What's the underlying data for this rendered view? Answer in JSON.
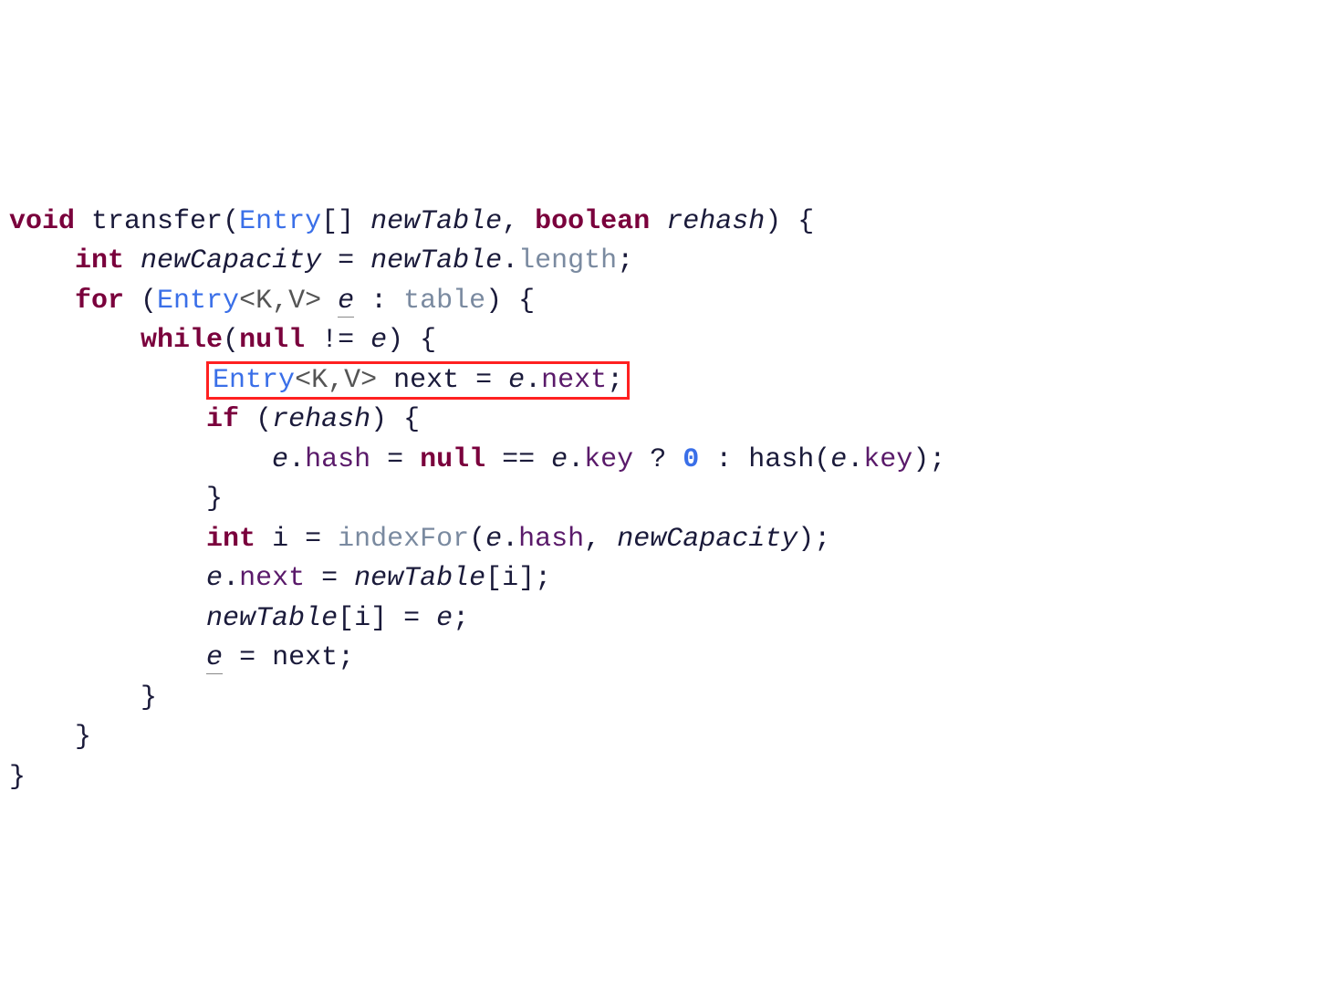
{
  "line1": {
    "void": "void",
    "fn": "transfer",
    "entry": "Entry",
    "brackets": "[]",
    "p1": "newTable",
    "comma": ", ",
    "boolean": "boolean",
    "p2": "rehash",
    "end": ") {"
  },
  "line2": {
    "int": "int",
    "var": "newCapacity",
    "eq": " = ",
    "obj": "newTable",
    "dot": ".",
    "length": "length",
    "semi": ";"
  },
  "line3": {
    "for": "for",
    "open": " (",
    "entry": "Entry",
    "tv": "<K,V>",
    "sp": " ",
    "e": "e",
    "colon": " : ",
    "table": "table",
    "end": ") {"
  },
  "line4": {
    "while": "while",
    "open": "(",
    "null": "null",
    "neq": " != ",
    "e": "e",
    "end": ") {"
  },
  "line5": {
    "entry": "Entry",
    "tv": "<K,V>",
    "next": " next = ",
    "e": "e",
    "dot": ".",
    "nextf": "next",
    "semi": ";"
  },
  "line6": {
    "if": "if",
    "open": " (",
    "rehash": "rehash",
    "end": ") {"
  },
  "line7": {
    "e1": "e",
    "dot1": ".",
    "hash": "hash",
    "eq": " = ",
    "null": "null",
    "eqeq": " == ",
    "e2": "e",
    "dot2": ".",
    "key1": "key",
    "tern": " ? ",
    "zero": "0",
    "colon": " : ",
    "hashfn": "hash",
    "open": "(",
    "e3": "e",
    "dot3": ".",
    "key2": "key",
    "end": ");"
  },
  "line8": {
    "brace": "}"
  },
  "line9": {
    "int": "int",
    "i": " i = ",
    "fn": "indexFor",
    "open": "(",
    "e": "e",
    "dot": ".",
    "hash": "hash",
    "comma": ", ",
    "nc": "newCapacity",
    "end": ");"
  },
  "line10": {
    "e": "e",
    "dot": ".",
    "next": "next",
    "eq": " = ",
    "nt": "newTable",
    "idx": "[i];"
  },
  "line11": {
    "nt": "newTable",
    "idx": "[i] = ",
    "e": "e",
    "semi": ";"
  },
  "line12": {
    "e": "e",
    "eq": " = ",
    "next": "next",
    "semi": ";"
  },
  "line13": {
    "brace": "}"
  },
  "line14": {
    "brace": "}"
  },
  "line15": {
    "brace": "}"
  }
}
